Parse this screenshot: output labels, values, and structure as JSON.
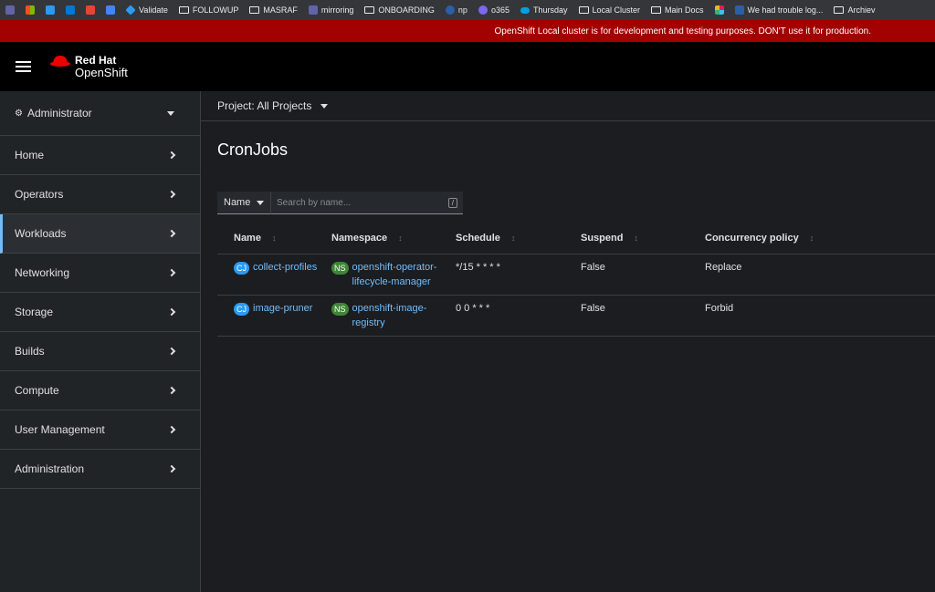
{
  "bookmarks": [
    {
      "label": "",
      "icon": "teams-icon",
      "color": "#6264a7"
    },
    {
      "label": "",
      "icon": "windows-icon",
      "color": "#f25022"
    },
    {
      "label": "",
      "icon": "app-icon",
      "color": "#2b9af3"
    },
    {
      "label": "",
      "icon": "outlook-icon",
      "color": "#0078d4"
    },
    {
      "label": "",
      "icon": "gmail-icon",
      "color": "#ea4335"
    },
    {
      "label": "",
      "icon": "calendar-icon",
      "color": "#4285f4"
    },
    {
      "label": "Validate",
      "icon": "diamond-icon",
      "color": "#2b9af3"
    },
    {
      "label": "FOLLOWUP",
      "icon": "folder-icon"
    },
    {
      "label": "MASRAF",
      "icon": "folder-icon"
    },
    {
      "label": "mirroring",
      "icon": "teams-icon",
      "color": "#6264a7"
    },
    {
      "label": "ONBOARDING",
      "icon": "folder-icon"
    },
    {
      "label": "np",
      "icon": "globe-icon",
      "color": "#2b5fa8"
    },
    {
      "label": "o365",
      "icon": "office-icon",
      "color": "#7b68ee"
    },
    {
      "label": "Thursday",
      "icon": "cloud-icon",
      "color": "#00a1e0"
    },
    {
      "label": "Local Cluster",
      "icon": "folder-icon"
    },
    {
      "label": "Main Docs",
      "icon": "folder-icon"
    },
    {
      "label": "",
      "icon": "slack-icon",
      "color": "#e01e5a"
    },
    {
      "label": "We had trouble log...",
      "icon": "x-icon",
      "color": "#2b5fa8"
    },
    {
      "label": "Archiev",
      "icon": "folder-icon"
    }
  ],
  "banner": {
    "text": "OpenShift Local cluster is for development and testing purposes. DON'T use it for production."
  },
  "masthead": {
    "brand_line1": "Red Hat",
    "brand_line2": "OpenShift"
  },
  "sidebar": {
    "perspective": "Administrator",
    "items": [
      {
        "label": "Home"
      },
      {
        "label": "Operators"
      },
      {
        "label": "Workloads"
      },
      {
        "label": "Networking"
      },
      {
        "label": "Storage"
      },
      {
        "label": "Builds"
      },
      {
        "label": "Compute"
      },
      {
        "label": "User Management"
      },
      {
        "label": "Administration"
      }
    ]
  },
  "main": {
    "project_label": "Project: All Projects",
    "title": "CronJobs",
    "filter": {
      "select": "Name",
      "placeholder": "Search by name...",
      "shortcut": "/"
    },
    "table": {
      "columns": [
        "Name",
        "Namespace",
        "Schedule",
        "Suspend",
        "Concurrency policy"
      ],
      "rows": [
        {
          "badge": "CJ",
          "name": "collect-profiles",
          "ns_badge": "NS",
          "ns_line1": "openshift-operator-",
          "ns_line2": "lifecycle-manager",
          "schedule": "*/15 * * * *",
          "suspend": "False",
          "concurrency": "Replace"
        },
        {
          "badge": "CJ",
          "name": "image-pruner",
          "ns_badge": "NS",
          "ns_line1": "openshift-image-",
          "ns_line2": "registry",
          "schedule": "0 0 * * *",
          "suspend": "False",
          "concurrency": "Forbid"
        }
      ]
    }
  }
}
